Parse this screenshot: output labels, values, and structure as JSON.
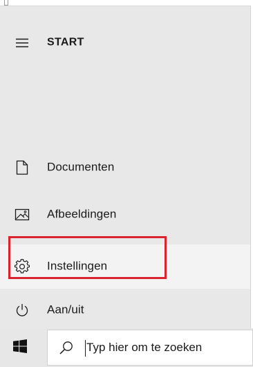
{
  "start_menu": {
    "header": {
      "icon": "hamburger-menu-icon",
      "label": "START"
    },
    "items": [
      {
        "icon": "document-icon",
        "label": "Documenten"
      },
      {
        "icon": "pictures-icon",
        "label": "Afbeeldingen"
      },
      {
        "icon": "gear-icon",
        "label": "Instellingen"
      },
      {
        "icon": "power-icon",
        "label": "Aan/uit"
      }
    ],
    "highlighted_item": "Instellingen",
    "highlight_color": "#d9232d"
  },
  "taskbar": {
    "start_icon": "windows-logo-icon",
    "search": {
      "icon": "search-icon",
      "placeholder": "Typ hier om te zoeken"
    }
  }
}
